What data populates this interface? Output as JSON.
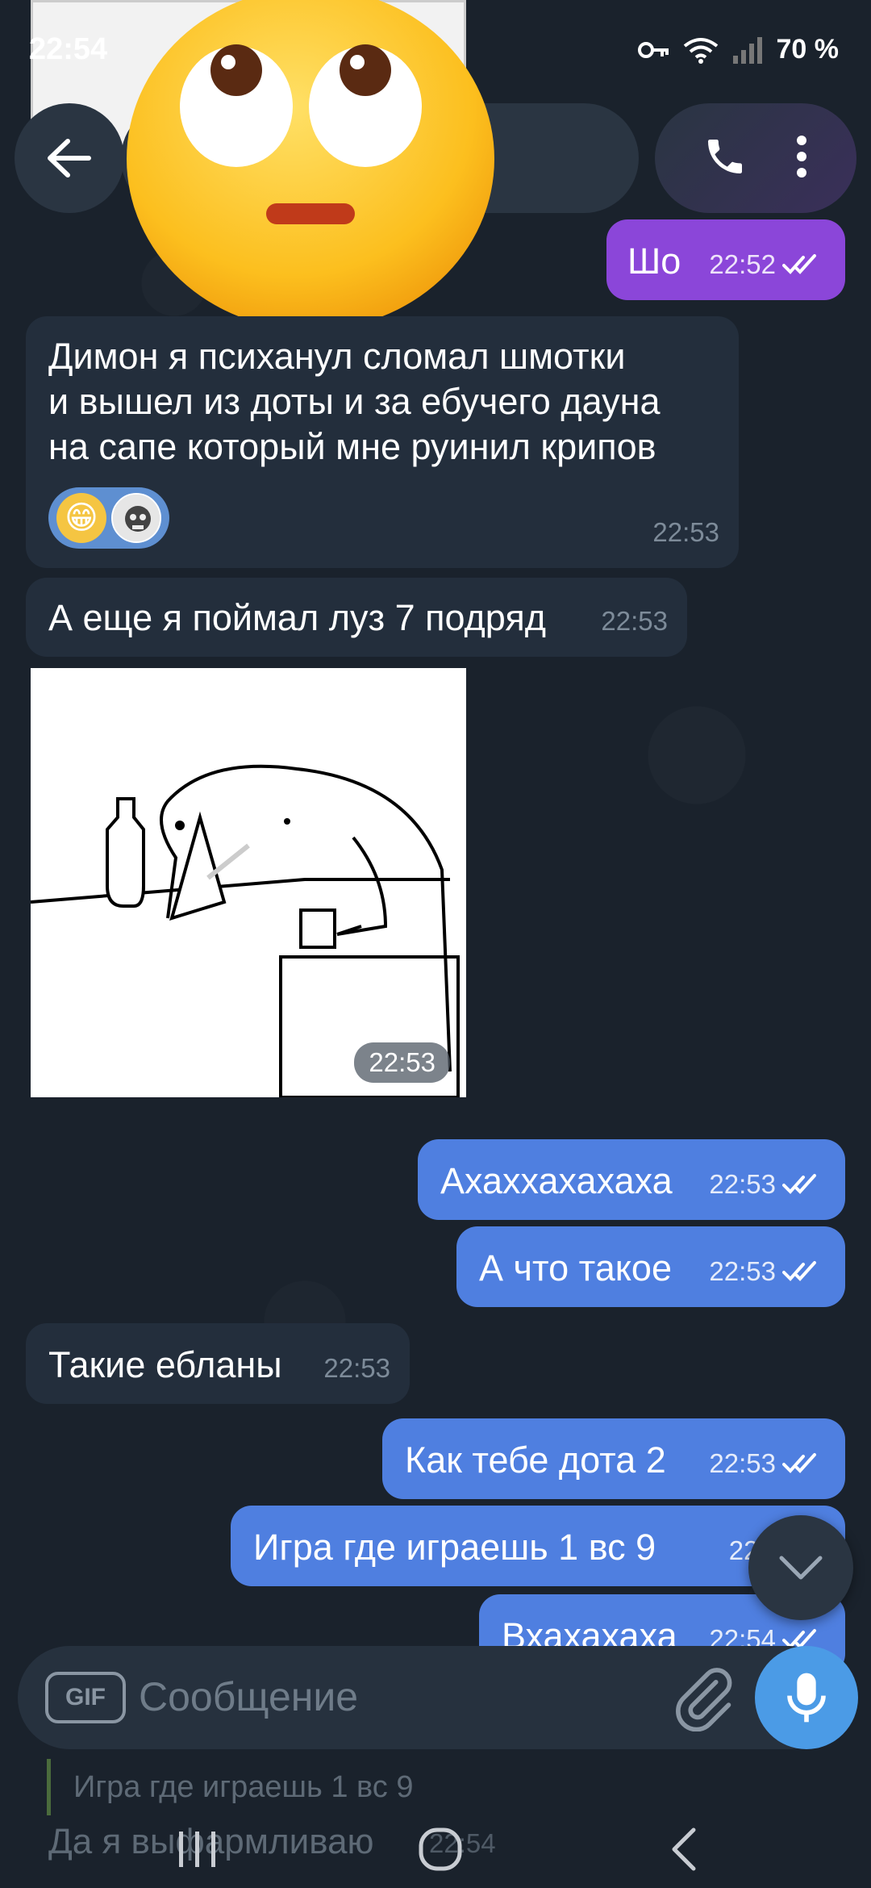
{
  "status_bar": {
    "time": "22:54",
    "battery": "70 %",
    "icons": [
      "key-icon",
      "wifi-icon",
      "signal-icon"
    ]
  },
  "header": {
    "back_icon": "arrow-left-icon",
    "call_icon": "phone-icon",
    "menu_icon": "more-vertical-icon"
  },
  "messages": [
    {
      "direction": "out",
      "text": "Шо",
      "time": "22:52",
      "read": true
    },
    {
      "direction": "in",
      "text_lines": [
        "Димон я психанул сломал шмотки",
        "и вышел из доты и за ебучего дауна",
        "на сапе который мне руинил крипов"
      ],
      "time": "22:53",
      "reaction": "😁"
    },
    {
      "direction": "in",
      "text": "А еще я поймал луз 7 подряд",
      "time": "22:53"
    },
    {
      "direction": "in",
      "type": "sticker",
      "time": "22:53"
    },
    {
      "direction": "out",
      "text": "Ахаххахахаха",
      "time": "22:53",
      "read": true
    },
    {
      "direction": "out",
      "text": "А что такое",
      "time": "22:53",
      "read": true
    },
    {
      "direction": "in",
      "text": "Такие ебланы",
      "time": "22:53"
    },
    {
      "direction": "out",
      "text": "Как тебе дота 2",
      "time": "22:53",
      "read": true
    },
    {
      "direction": "out",
      "text": "Игра где играешь 1 вс 9",
      "time": "22:5",
      "read": true
    },
    {
      "direction": "out",
      "text": "Вхахахаха",
      "time": "22:54",
      "read": true
    }
  ],
  "composer": {
    "gif_label": "GIF",
    "placeholder": "Сообщение",
    "attach_icon": "paperclip-icon",
    "mic_icon": "microphone-icon"
  },
  "reply_preview": {
    "quote": "Игра где играешь 1 вс 9",
    "text": "Да я выфармливаю",
    "time": "22:54"
  },
  "colors": {
    "background": "#1a222c",
    "incoming": "#232e3c",
    "outgoing": "#4f7fe0",
    "outgoing_violet": "#8b46d9",
    "accent": "#4b9be6"
  }
}
